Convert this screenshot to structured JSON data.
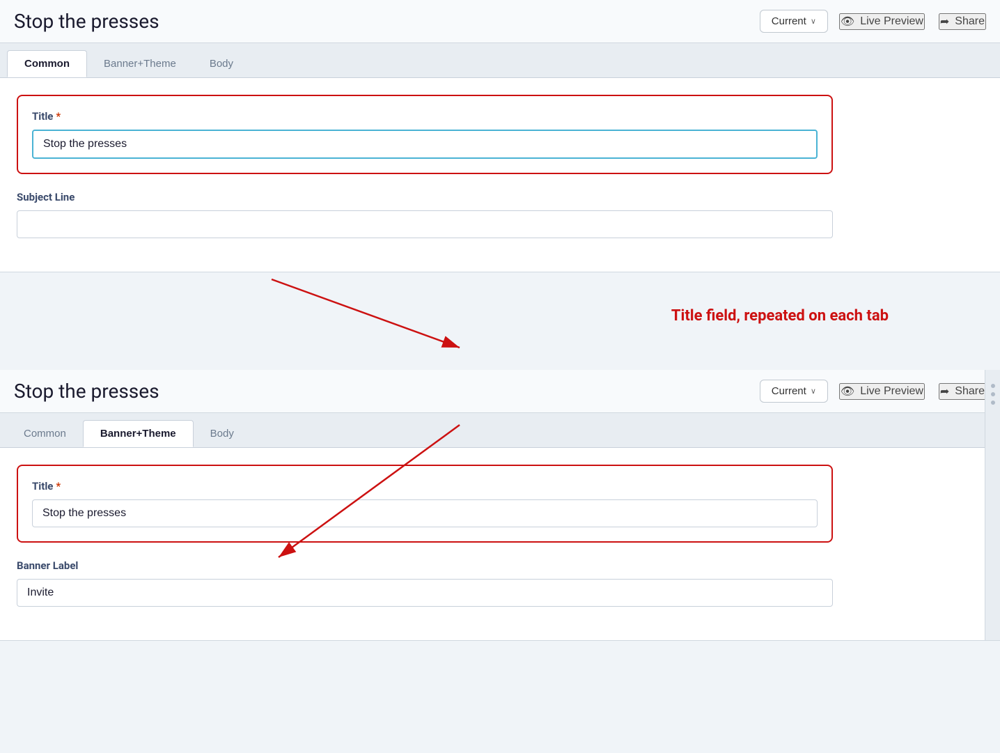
{
  "panel1": {
    "title": "Stop the presses",
    "current_btn": "Current",
    "chevron": "∨",
    "live_preview": "Live Preview",
    "share": "Share",
    "tabs": [
      {
        "label": "Common",
        "active": true
      },
      {
        "label": "Banner+Theme",
        "active": false
      },
      {
        "label": "Body",
        "active": false
      }
    ],
    "title_field": {
      "label": "Title",
      "required": "*",
      "value": "Stop the presses",
      "placeholder": ""
    },
    "subject_line_field": {
      "label": "Subject Line",
      "value": "",
      "placeholder": ""
    }
  },
  "annotation": {
    "text": "Title field, repeated on each tab"
  },
  "panel2": {
    "title": "Stop the presses",
    "current_btn": "Current",
    "chevron": "∨",
    "live_preview": "Live Preview",
    "share": "Share",
    "tabs": [
      {
        "label": "Common",
        "active": false
      },
      {
        "label": "Banner+Theme",
        "active": true
      },
      {
        "label": "Body",
        "active": false
      }
    ],
    "title_field": {
      "label": "Title",
      "required": "*",
      "value": "Stop the presses",
      "placeholder": ""
    },
    "banner_label_field": {
      "label": "Banner Label",
      "value": "Invite",
      "placeholder": ""
    }
  },
  "icons": {
    "eye": "👁",
    "share_arrow": "➦"
  }
}
